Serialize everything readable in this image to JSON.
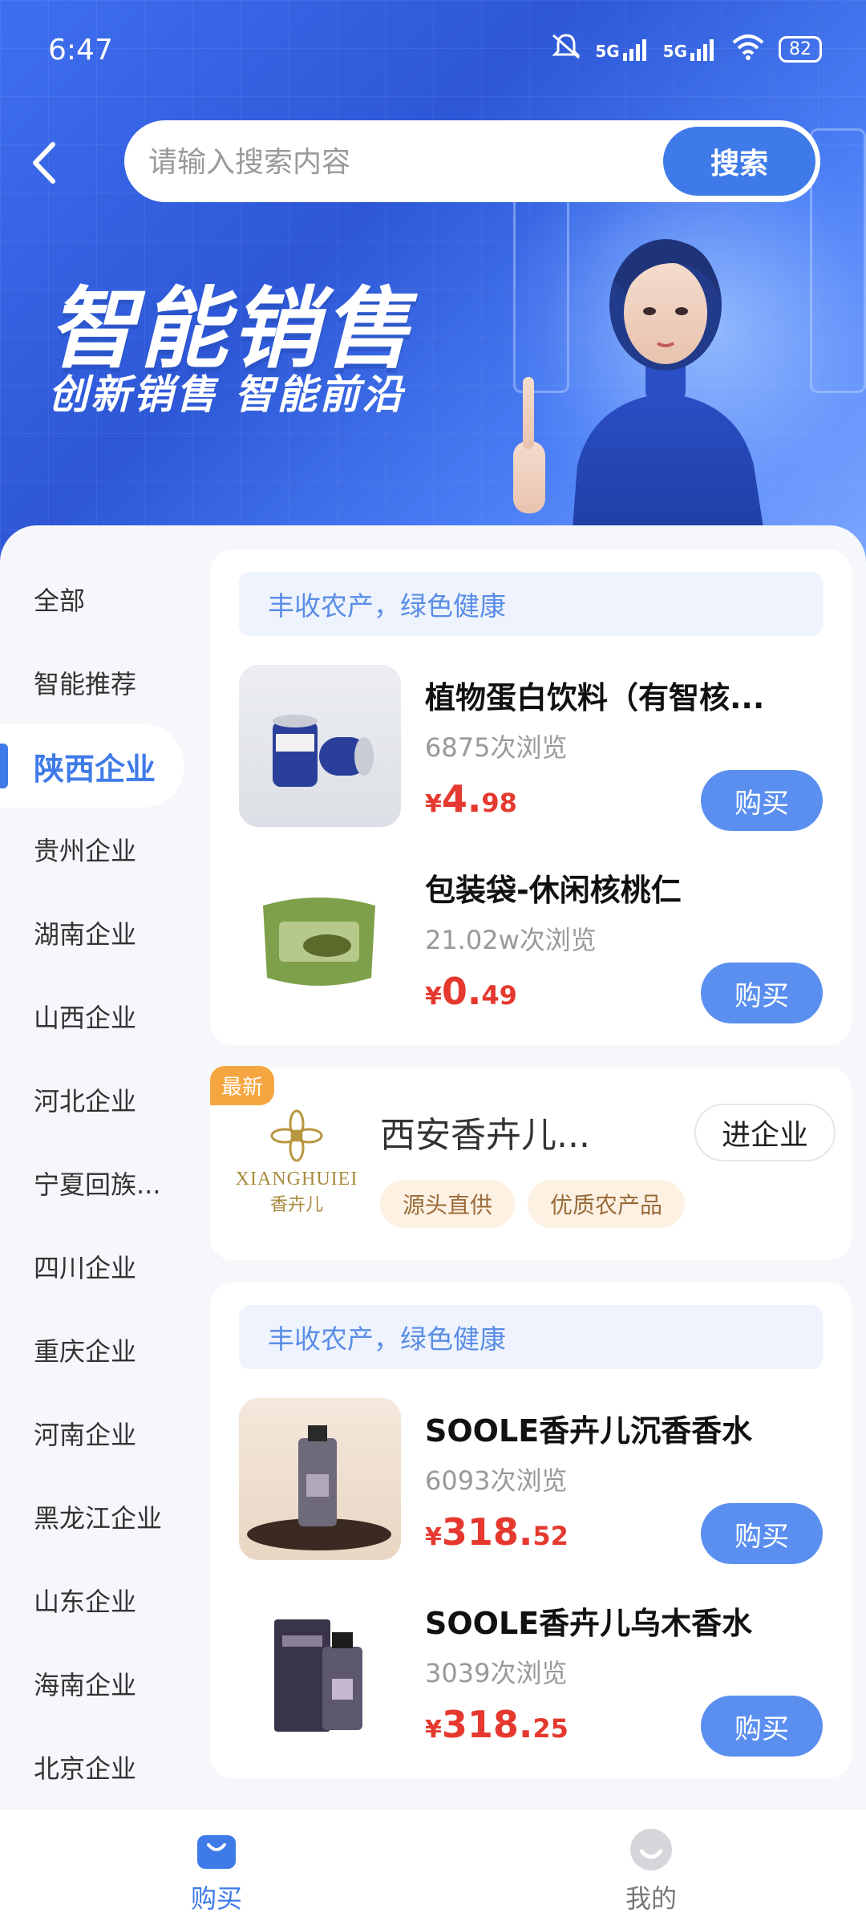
{
  "status_bar": {
    "time": "6:47",
    "signal1": "5G",
    "signal2": "5G",
    "battery": "82"
  },
  "search": {
    "placeholder": "请输入搜索内容",
    "button": "搜索"
  },
  "banner": {
    "title": "智能销售",
    "subtitle": "创新销售  智能前沿"
  },
  "sidebar": {
    "items": [
      {
        "label": "全部"
      },
      {
        "label": "智能推荐"
      },
      {
        "label": "陕西企业"
      },
      {
        "label": "贵州企业"
      },
      {
        "label": "湖南企业"
      },
      {
        "label": "山西企业"
      },
      {
        "label": "河北企业"
      },
      {
        "label": "宁夏回族..."
      },
      {
        "label": "四川企业"
      },
      {
        "label": "重庆企业"
      },
      {
        "label": "河南企业"
      },
      {
        "label": "黑龙江企业"
      },
      {
        "label": "山东企业"
      },
      {
        "label": "海南企业"
      },
      {
        "label": "北京企业"
      }
    ],
    "active": "陕西企业"
  },
  "cards": [
    {
      "banner": "丰收农产，绿色健康",
      "products": [
        {
          "name": "植物蛋白饮料（有智核...",
          "views": "6875次浏览",
          "currency": "¥",
          "price_int": "4.",
          "price_dec": "98",
          "buy": "购买"
        },
        {
          "name": "包装袋-休闲核桃仁",
          "views": "21.02w次浏览",
          "currency": "¥",
          "price_int": "0.",
          "price_dec": "49",
          "buy": "购买"
        }
      ]
    },
    {
      "banner": "丰收农产，绿色健康",
      "products": [
        {
          "name": "SOOLE香卉儿沉香香水",
          "views": "6093次浏览",
          "currency": "¥",
          "price_int": "318.",
          "price_dec": "52",
          "buy": "购买"
        },
        {
          "name": "SOOLE香卉儿乌木香水",
          "views": "3039次浏览",
          "currency": "¥",
          "price_int": "318.",
          "price_dec": "25",
          "buy": "购买"
        }
      ]
    }
  ],
  "enterprise": {
    "badge": "最新",
    "logo_text_en": "XIANGHUIEI",
    "logo_text_cn": "香卉儿",
    "name": "西安香卉儿...",
    "button": "进企业",
    "tags": [
      "源头直供",
      "优质农产品"
    ]
  },
  "bottom_nav": {
    "buy": "购买",
    "mine": "我的"
  },
  "colors": {
    "accent": "#3f7be8",
    "price": "#e5392f",
    "tag_bg": "#fdf1e3"
  }
}
